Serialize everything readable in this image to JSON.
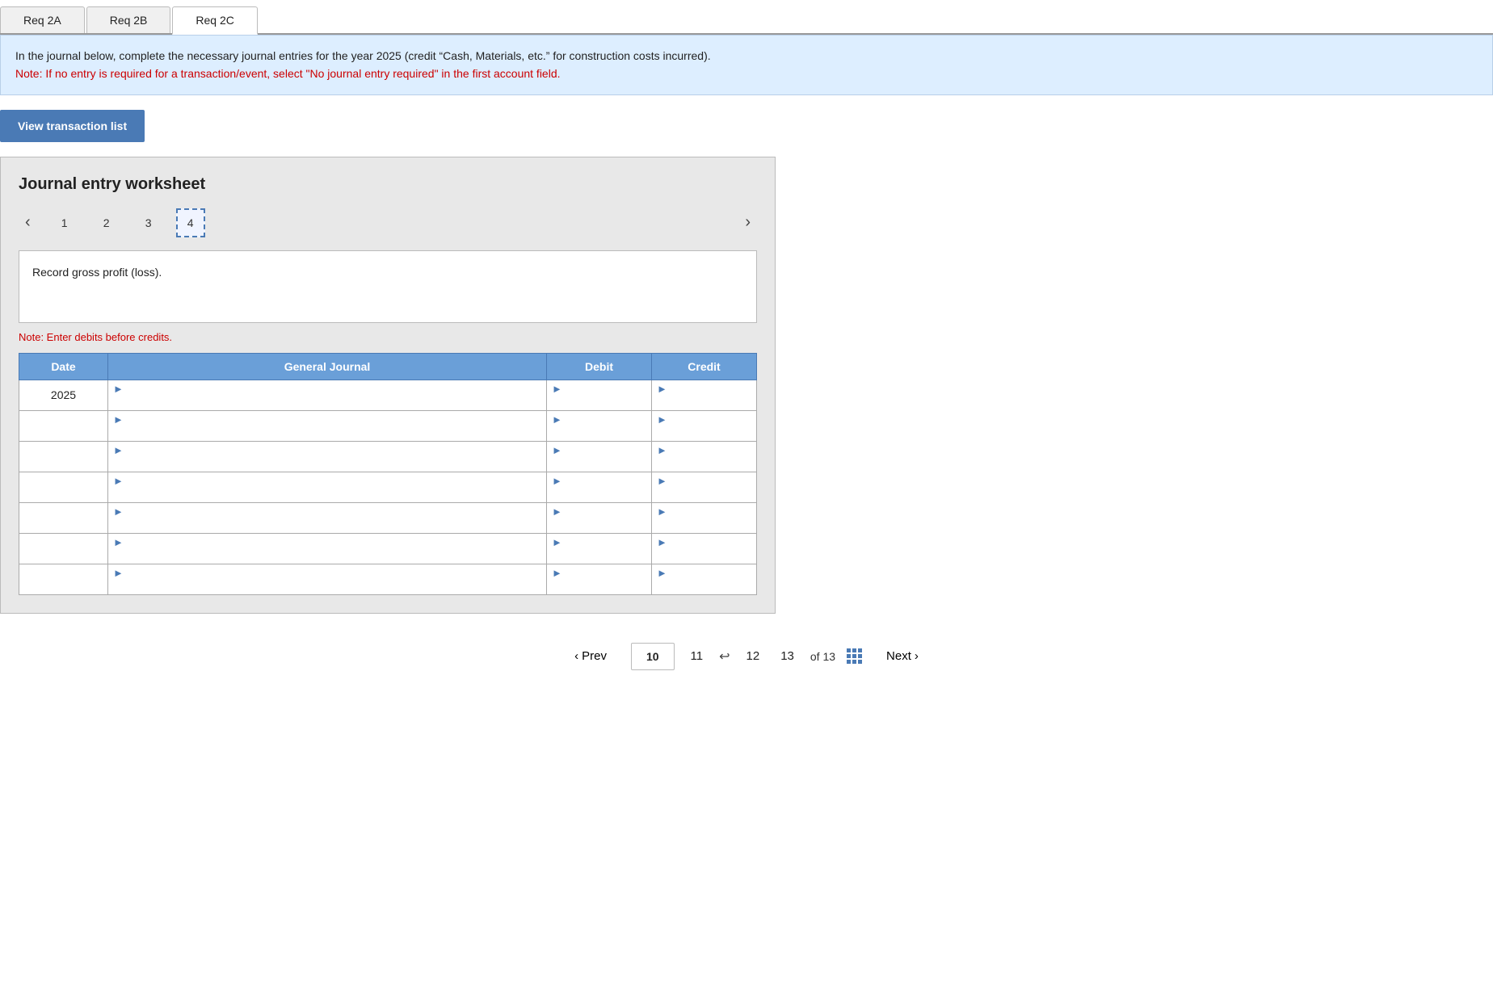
{
  "tabs": [
    {
      "id": "req2a",
      "label": "Req 2A",
      "active": false
    },
    {
      "id": "req2b",
      "label": "Req 2B",
      "active": false
    },
    {
      "id": "req2c",
      "label": "Req 2C",
      "active": true
    }
  ],
  "instruction": {
    "main_text": "In the journal below, complete the necessary journal entries for the year 2025 (credit “Cash, Materials, etc.” for construction costs incurred).",
    "note_text": "Note: If no entry is required for a transaction/event, select \"No journal entry required\" in the first account field."
  },
  "view_transactions_btn": "View transaction list",
  "worksheet": {
    "title": "Journal entry worksheet",
    "steps": [
      {
        "label": "1",
        "active": false
      },
      {
        "label": "2",
        "active": false
      },
      {
        "label": "3",
        "active": false
      },
      {
        "label": "4",
        "active": true
      }
    ],
    "description": "Record gross profit (loss).",
    "note_debits": "Note: Enter debits before credits.",
    "table": {
      "headers": [
        "Date",
        "General Journal",
        "Debit",
        "Credit"
      ],
      "rows": [
        {
          "date": "2025",
          "journal": "",
          "debit": "",
          "credit": ""
        },
        {
          "date": "",
          "journal": "",
          "debit": "",
          "credit": ""
        },
        {
          "date": "",
          "journal": "",
          "debit": "",
          "credit": ""
        },
        {
          "date": "",
          "journal": "",
          "debit": "",
          "credit": ""
        },
        {
          "date": "",
          "journal": "",
          "debit": "",
          "credit": ""
        },
        {
          "date": "",
          "journal": "",
          "debit": "",
          "credit": ""
        },
        {
          "date": "",
          "journal": "",
          "debit": "",
          "credit": ""
        }
      ]
    }
  },
  "pagination": {
    "prev_label": "Prev",
    "next_label": "Next",
    "current_page": "10",
    "pages": [
      "11",
      "12",
      "13"
    ],
    "of_text": "of 13"
  }
}
